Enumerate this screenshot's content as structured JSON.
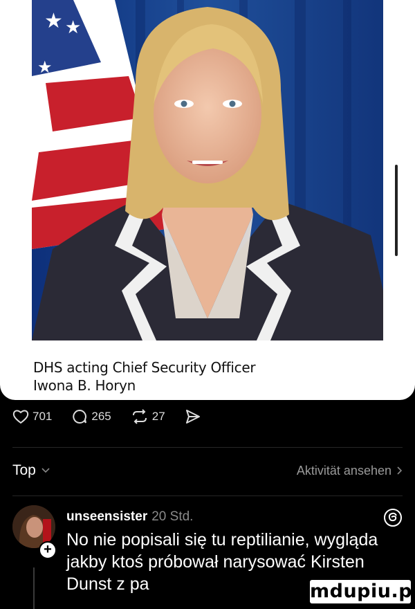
{
  "post": {
    "caption_line1": "DHS acting Chief Security Officer",
    "caption_line2": "Iwona B. Horyn"
  },
  "actions": {
    "likes": "701",
    "comments": "265",
    "reposts": "27"
  },
  "sort": {
    "label": "Top",
    "activity_link": "Aktivität ansehen"
  },
  "comment": {
    "username": "unseensister",
    "time": "20 Std.",
    "text": "No nie popisali się tu reptilianie, wygląda jakby ktoś próbował narysować Kirsten Dunst z pa"
  },
  "watermark": "mdupiu.pl",
  "icons": [
    "heart-icon",
    "comment-icon",
    "repost-icon",
    "share-icon",
    "chevron-down-icon",
    "chevron-right-icon",
    "threads-icon",
    "plus-icon"
  ]
}
